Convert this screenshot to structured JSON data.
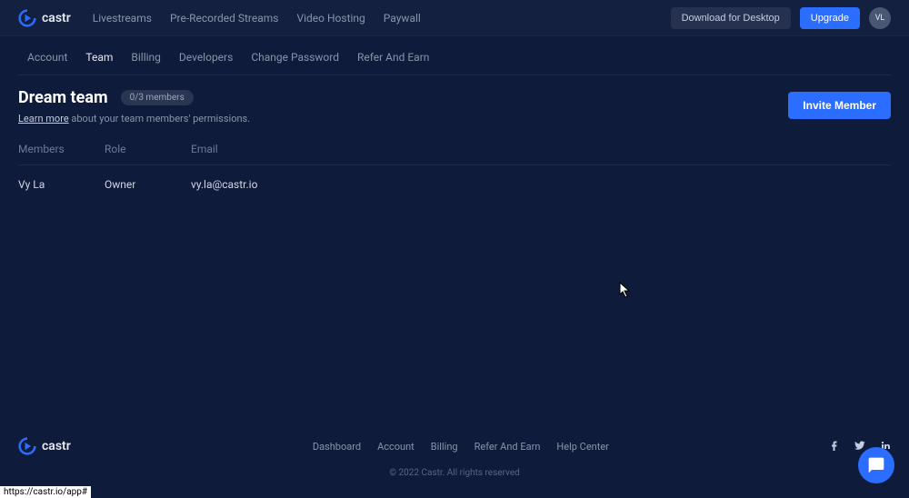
{
  "brand": "castr",
  "topnav": [
    "Livestreams",
    "Pre-Recorded Streams",
    "Video Hosting",
    "Paywall"
  ],
  "actions": {
    "download": "Download for Desktop",
    "upgrade": "Upgrade",
    "avatar": "VL"
  },
  "subnav": [
    "Account",
    "Team",
    "Billing",
    "Developers",
    "Change Password",
    "Refer And Earn"
  ],
  "active_tab": 1,
  "page": {
    "title": "Dream team",
    "badge": "0/3 members",
    "learn_more": "Learn more",
    "subtext": " about your team members' permissions.",
    "invite": "Invite Member"
  },
  "table": {
    "headers": {
      "members": "Members",
      "role": "Role",
      "email": "Email"
    },
    "rows": [
      {
        "name": "Vy La",
        "role": "Owner",
        "email": "vy.la@castr.io"
      }
    ]
  },
  "footer": {
    "nav": [
      "Dashboard",
      "Account",
      "Billing",
      "Refer And Earn",
      "Help Center"
    ],
    "copyright": "© 2022 Castr. All rights reserved"
  },
  "status_url": "https://castr.io/app#"
}
